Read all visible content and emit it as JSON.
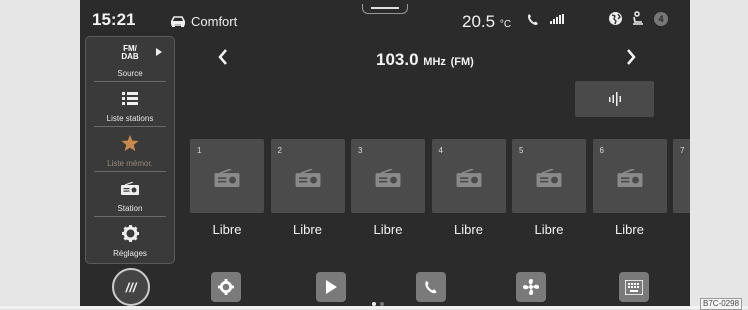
{
  "status_bar": {
    "time": "15:21",
    "profile": "Comfort",
    "temperature": "20.5",
    "temperature_unit": "°C",
    "notification_count": "4"
  },
  "menu": {
    "items": [
      {
        "label": "Source",
        "icon": "fm-dab-icon",
        "icon_text": [
          "FM/",
          "DAB"
        ]
      },
      {
        "label": "Liste stations",
        "icon": "list-icon"
      },
      {
        "label": "Liste mémor.",
        "icon": "star-icon"
      },
      {
        "label": "Station",
        "icon": "radio-icon"
      },
      {
        "label": "Réglages",
        "icon": "gear-icon"
      }
    ]
  },
  "station": {
    "frequency": "103.0",
    "unit": "MHz",
    "band": "(FM)"
  },
  "presets": [
    {
      "number": "1",
      "label": "Libre"
    },
    {
      "number": "2",
      "label": "Libre"
    },
    {
      "number": "3",
      "label": "Libre"
    },
    {
      "number": "4",
      "label": "Libre"
    },
    {
      "number": "5",
      "label": "Libre"
    },
    {
      "number": "6",
      "label": "Libre"
    },
    {
      "number": "7",
      "label": ""
    }
  ],
  "dock": {
    "home_label": "///",
    "apps": [
      "settings-icon",
      "play-icon",
      "phone-icon",
      "fan-icon",
      "keyboard-icon"
    ]
  },
  "page_indicator": {
    "active": 1,
    "count": 2
  },
  "image_code": "B7C-0298",
  "colors": {
    "screen_bg": "#2b2b2b",
    "tile_bg": "#4b4b4b",
    "star": "#c88a4a",
    "dock_button": "#7a7a7a"
  }
}
